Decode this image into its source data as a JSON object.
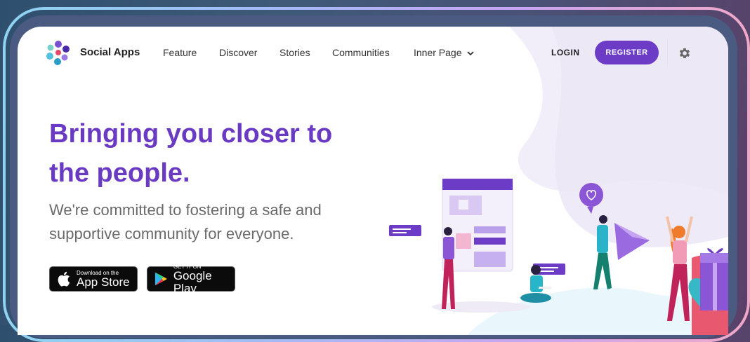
{
  "nav": {
    "brand": "Social Apps",
    "items": [
      "Feature",
      "Discover",
      "Stories",
      "Communities",
      "Inner Page"
    ],
    "login": "LOGIN",
    "register": "REGISTER"
  },
  "hero": {
    "title_line1": "Bringing you closer to",
    "title_line2": "the people.",
    "subtitle_line1": "We're committed to fostering a safe and",
    "subtitle_line2": "supportive community for everyone."
  },
  "stores": {
    "apple_small": "Download on the",
    "apple_big": "App Store",
    "google_small": "GET IT ON",
    "google_big": "Google Play"
  },
  "icons": {
    "logo": "flower-logo-icon",
    "dropdown": "chevron-down-icon",
    "settings": "gear-icon",
    "apple": "apple-icon",
    "google_play": "google-play-icon"
  },
  "colors": {
    "accent": "#6c3cc6",
    "title": "#6a3bc2",
    "subtitle": "#6a6a6a"
  }
}
